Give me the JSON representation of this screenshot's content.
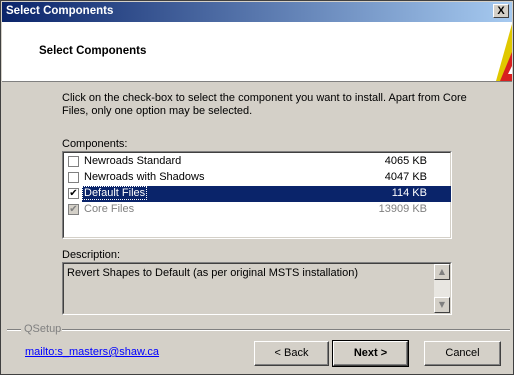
{
  "window": {
    "title": "Select Components",
    "close_label": "X"
  },
  "header": {
    "title": "Select Components"
  },
  "instructions": "Click on the check-box to select the component you want to install.  Apart from Core Files, only one option may be selected.",
  "components": {
    "label": "Components:",
    "items": [
      {
        "name": "Newroads Standard",
        "size": "4065 KB",
        "checked": false,
        "selected": false,
        "disabled": false
      },
      {
        "name": "Newroads with Shadows",
        "size": "4047 KB",
        "checked": false,
        "selected": false,
        "disabled": false
      },
      {
        "name": "Default Files",
        "size": "114 KB",
        "checked": true,
        "selected": true,
        "disabled": false
      },
      {
        "name": "Core Files",
        "size": "13909 KB",
        "checked": true,
        "selected": false,
        "disabled": true
      }
    ]
  },
  "description": {
    "label": "Description:",
    "text": "Revert Shapes to Default (as per original MSTS installation)"
  },
  "footer": {
    "group_label": "QSetup",
    "link": "mailto:s_masters@shaw.ca",
    "back_label": "< Back",
    "next_label": "Next >",
    "cancel_label": "Cancel"
  },
  "colors": {
    "title_start": "#0a246a",
    "title_end": "#a6caf0",
    "selection": "#0a246a",
    "link": "#0000ff"
  }
}
